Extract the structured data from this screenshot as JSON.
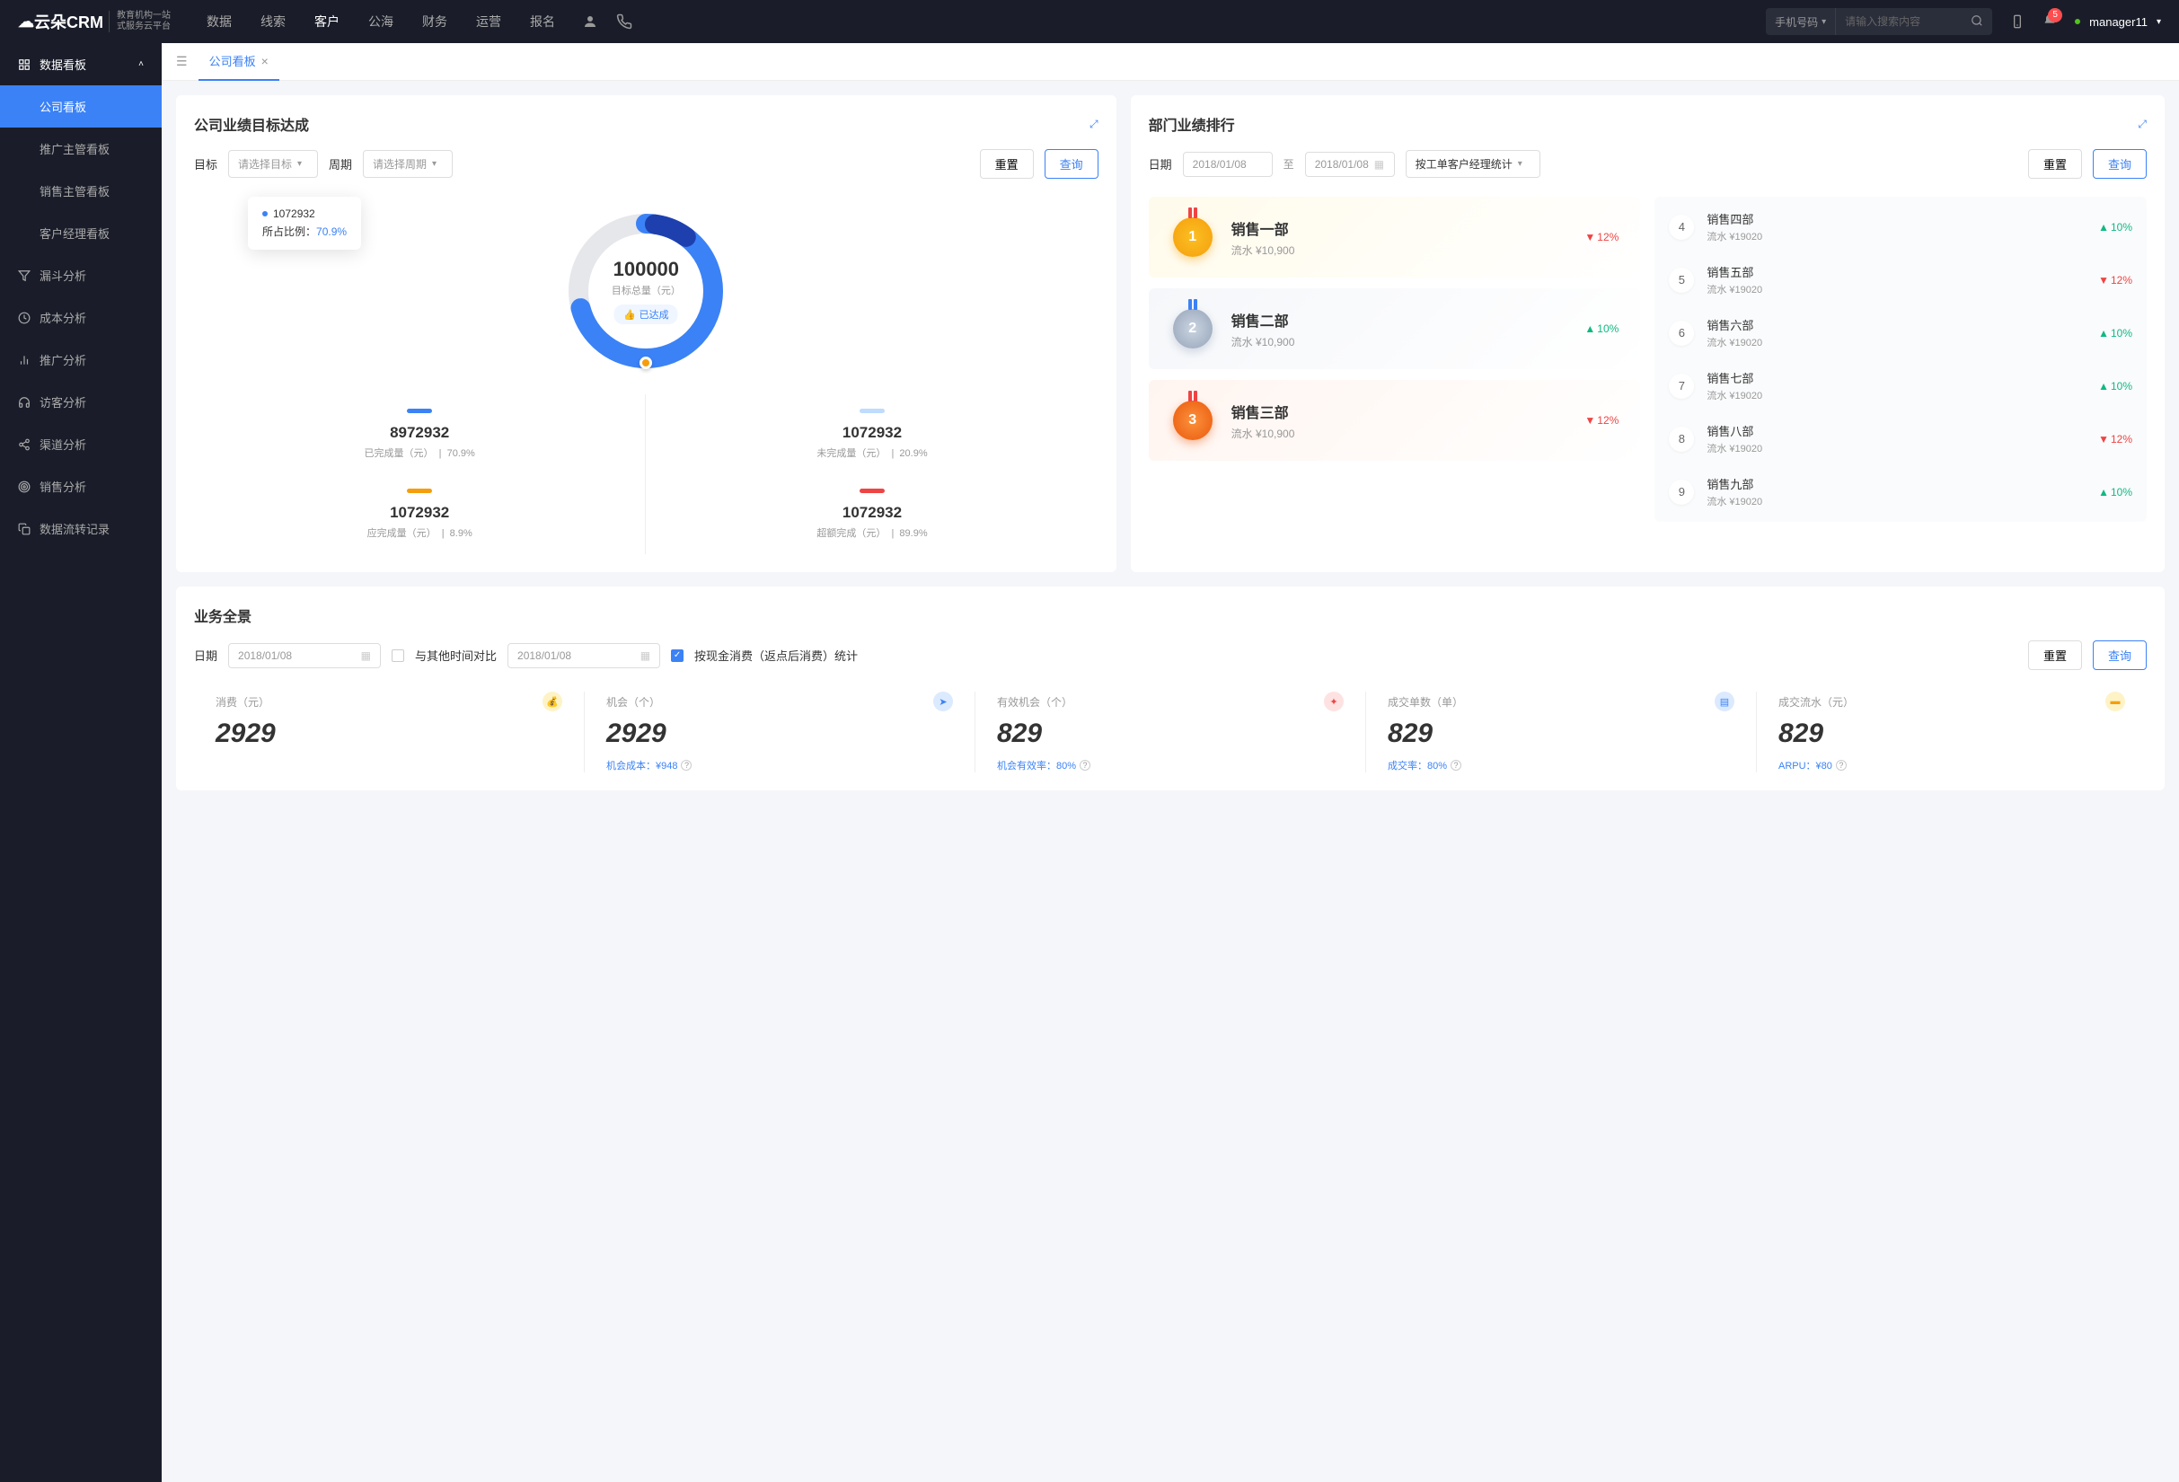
{
  "brand": {
    "name": "云朵CRM",
    "sub1": "教育机构一站",
    "sub2": "式服务云平台"
  },
  "nav": {
    "items": [
      "数据",
      "线索",
      "客户",
      "公海",
      "财务",
      "运营",
      "报名"
    ],
    "active": 2
  },
  "search": {
    "type": "手机号码",
    "placeholder": "请输入搜索内容"
  },
  "bell_count": "5",
  "user": {
    "name": "manager11"
  },
  "sidebar": {
    "group": "数据看板",
    "subs": [
      "公司看板",
      "推广主管看板",
      "销售主管看板",
      "客户经理看板"
    ],
    "active": 0,
    "items": [
      "漏斗分析",
      "成本分析",
      "推广分析",
      "访客分析",
      "渠道分析",
      "销售分析",
      "数据流转记录"
    ]
  },
  "tab": {
    "label": "公司看板"
  },
  "goal": {
    "title": "公司业绩目标达成",
    "labels": {
      "target": "目标",
      "period": "周期",
      "reset": "重置",
      "query": "查询",
      "target_ph": "请选择目标",
      "period_ph": "请选择周期"
    },
    "center": {
      "value": "100000",
      "label": "目标总量（元）",
      "badge": "已达成"
    },
    "tooltip": {
      "value": "1072932",
      "ratio_label": "所占比例：",
      "ratio": "70.9%"
    },
    "stats": [
      {
        "bar": "#3b82f6",
        "val": "8972932",
        "label": "已完成量（元）",
        "pct": "70.9%"
      },
      {
        "bar": "#bfdbfe",
        "val": "1072932",
        "label": "未完成量（元）",
        "pct": "20.9%"
      },
      {
        "bar": "#f59e0b",
        "val": "1072932",
        "label": "应完成量（元）",
        "pct": "8.9%"
      },
      {
        "bar": "#ef4444",
        "val": "1072932",
        "label": "超额完成（元）",
        "pct": "89.9%"
      }
    ]
  },
  "rank": {
    "title": "部门业绩排行",
    "labels": {
      "date": "日期",
      "to": "至",
      "reset": "重置",
      "query": "查询",
      "stat_by": "按工单客户经理统计"
    },
    "date_from": "2018/01/08",
    "date_to": "2018/01/08",
    "top": [
      {
        "pos": "1",
        "cls": "gold",
        "name": "销售一部",
        "sub": "流水 ¥10,900",
        "pct": "12%",
        "dir": "down"
      },
      {
        "pos": "2",
        "cls": "silver",
        "name": "销售二部",
        "sub": "流水 ¥10,900",
        "pct": "10%",
        "dir": "up"
      },
      {
        "pos": "3",
        "cls": "bronze",
        "name": "销售三部",
        "sub": "流水 ¥10,900",
        "pct": "12%",
        "dir": "down"
      }
    ],
    "rest": [
      {
        "pos": "4",
        "name": "销售四部",
        "sub": "流水 ¥19020",
        "pct": "10%",
        "dir": "up"
      },
      {
        "pos": "5",
        "name": "销售五部",
        "sub": "流水 ¥19020",
        "pct": "12%",
        "dir": "down"
      },
      {
        "pos": "6",
        "name": "销售六部",
        "sub": "流水 ¥19020",
        "pct": "10%",
        "dir": "up"
      },
      {
        "pos": "7",
        "name": "销售七部",
        "sub": "流水 ¥19020",
        "pct": "10%",
        "dir": "up"
      },
      {
        "pos": "8",
        "name": "销售八部",
        "sub": "流水 ¥19020",
        "pct": "12%",
        "dir": "down"
      },
      {
        "pos": "9",
        "name": "销售九部",
        "sub": "流水 ¥19020",
        "pct": "10%",
        "dir": "up"
      }
    ]
  },
  "overview": {
    "title": "业务全景",
    "labels": {
      "date": "日期",
      "compare": "与其他时间对比",
      "stat_by": "按现金消费（返点后消费）统计",
      "reset": "重置",
      "query": "查询"
    },
    "date1": "2018/01/08",
    "date2": "2018/01/08",
    "items": [
      {
        "label": "消费（元）",
        "val": "2929",
        "foot": "",
        "icon_bg": "#fef3c7",
        "icon_color": "#f59e0b",
        "icon": "💰"
      },
      {
        "label": "机会（个）",
        "val": "2929",
        "foot": "机会成本：¥948",
        "icon_bg": "#dbeafe",
        "icon_color": "#3b82f6",
        "icon": "➤"
      },
      {
        "label": "有效机会（个）",
        "val": "829",
        "foot": "机会有效率：80%",
        "icon_bg": "#fee2e2",
        "icon_color": "#ef4444",
        "icon": "✦"
      },
      {
        "label": "成交单数（单）",
        "val": "829",
        "foot": "成交率：80%",
        "icon_bg": "#dbeafe",
        "icon_color": "#3b82f6",
        "icon": "▤"
      },
      {
        "label": "成交流水（元）",
        "val": "829",
        "foot": "ARPU：¥80",
        "icon_bg": "#fef3c7",
        "icon_color": "#f59e0b",
        "icon": "▬"
      }
    ]
  },
  "chart_data": {
    "type": "pie",
    "title": "目标总量（元）",
    "total": 100000,
    "series": [
      {
        "name": "已完成量（元）",
        "value": 8972932,
        "pct": 70.9
      },
      {
        "name": "未完成量（元）",
        "value": 1072932,
        "pct": 20.9
      },
      {
        "name": "应完成量（元）",
        "value": 1072932,
        "pct": 8.9
      },
      {
        "name": "超额完成（元）",
        "value": 1072932,
        "pct": 89.9
      }
    ],
    "highlighted": {
      "value": 1072932,
      "ratio": 70.9
    }
  }
}
